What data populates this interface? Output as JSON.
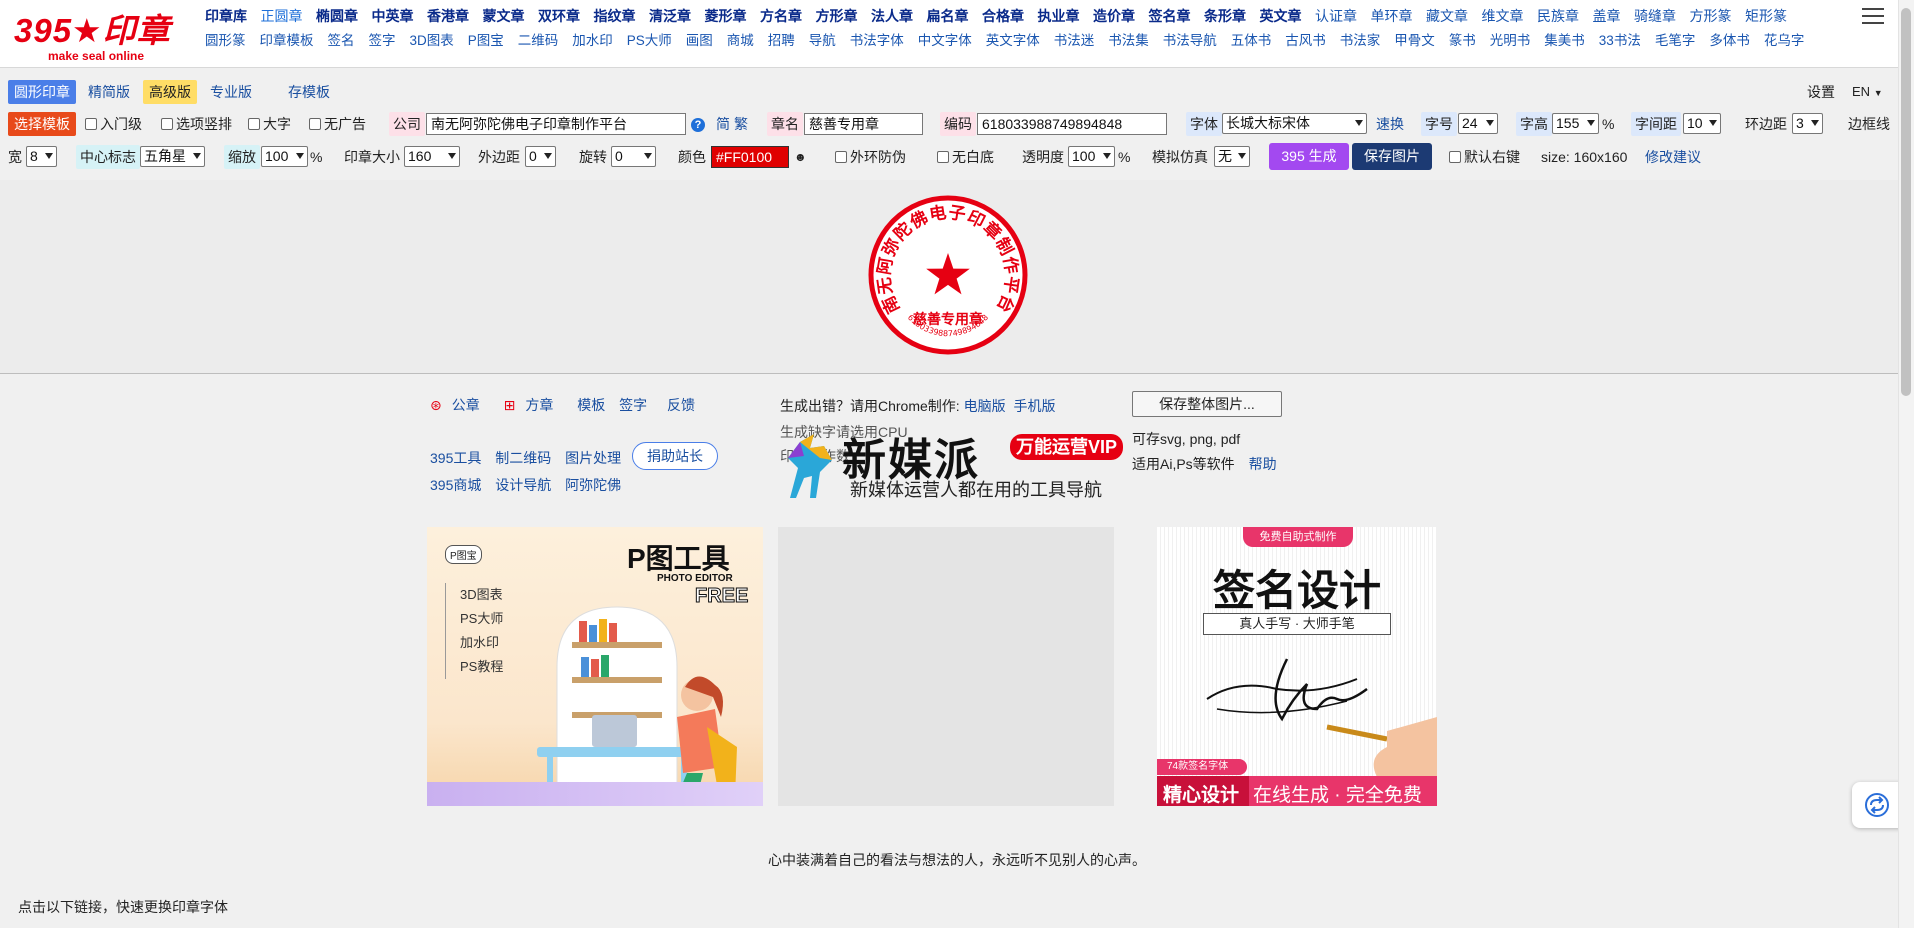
{
  "logo": {
    "title": "395★印章",
    "subtitle": "make seal online"
  },
  "nav": {
    "row1": [
      "印章库",
      "正圆章",
      "椭圆章",
      "中英章",
      "香港章",
      "蒙文章",
      "双环章",
      "指纹章",
      "清泛章",
      "菱形章",
      "方名章",
      "方形章",
      "法人章",
      "扁名章",
      "合格章",
      "执业章",
      "造价章",
      "签名章",
      "条形章",
      "英文章",
      "认证章",
      "单环章",
      "藏文章",
      "维文章",
      "民族章",
      "盖章",
      "骑缝章",
      "方形篆",
      "矩形篆"
    ],
    "row2": [
      "圆形篆",
      "印章模板",
      "签名",
      "签字",
      "3D图表",
      "P图宝",
      "二维码",
      "加水印",
      "PS大师",
      "画图",
      "商城",
      "招聘",
      "导航",
      "书法字体",
      "中文字体",
      "英文字体",
      "书法迷",
      "书法集",
      "书法导航",
      "五体书",
      "古风书",
      "书法家",
      "甲骨文",
      "篆书",
      "光明书",
      "集美书",
      "33书法",
      "毛笔字",
      "多体书",
      "花乌字"
    ]
  },
  "toolbar": {
    "tabs": [
      "圆形印章",
      "精简版",
      "高级版",
      "专业版",
      "存模板"
    ],
    "settings": "设置",
    "lang": "EN",
    "choose_template": "选择模板",
    "opt_beginner": "入门级",
    "opt_vertical": "选项竖排",
    "opt_bigchar": "大字",
    "opt_noad": "无广告",
    "company_label": "公司",
    "company_value": "南无阿弥陀佛电子印章制作平台",
    "simp": "简",
    "trad": "繁",
    "seal_name_label": "章名",
    "seal_name_value": "慈善专用章",
    "code_label": "编码",
    "code_value": "618033988749894848",
    "font_label": "字体",
    "font_value": "长城大标宋体",
    "quick_switch": "速换",
    "font_size_label": "字号",
    "font_size_value": "24",
    "char_height_label": "字高",
    "char_height_value": "155",
    "percent": "%",
    "spacing_label": "字间距",
    "spacing_value": "10",
    "ring_margin_label": "环边距",
    "ring_margin_value": "3",
    "border_label": "边框线",
    "width_label": "宽",
    "width_value": "8",
    "center_logo_label": "中心标志",
    "center_logo_value": "五角星",
    "scale_label": "缩放",
    "scale_value": "100",
    "seal_size_label": "印章大小",
    "seal_size_value": "160",
    "outer_margin_label": "外边距",
    "outer_margin_value": "0",
    "rotate_label": "旋转",
    "rotate_value": "0",
    "color_label": "颜色",
    "color_value": "#FF0100",
    "anti_fake": "外环防伪",
    "no_white": "无白底",
    "opacity_label": "透明度",
    "opacity_value": "100",
    "sim_label": "模拟仿真",
    "sim_value": "无",
    "generate": "395 生成",
    "save_image": "保存图片",
    "default_right": "默认右键",
    "size_info": "size: 160x160",
    "suggest": "修改建议"
  },
  "stamp": {
    "company": "南无阿弥陀佛电子印章制作平台",
    "name": "慈善专用章",
    "code": "618033988749894848",
    "color": "#e60012"
  },
  "links": {
    "row1": [
      "公章",
      "方章",
      "模板",
      "签字",
      "反馈"
    ],
    "row2": [
      "395工具",
      "制二维码",
      "图片处理"
    ],
    "row3": [
      "395商城",
      "设计导航",
      "阿弥陀佛"
    ],
    "donate": "捐助站长"
  },
  "info": {
    "error_line": "生成出错？请用Chrome制作:",
    "pc": "电脑版",
    "mobile": "手机版",
    "save_full": "保存整体图片...",
    "formats": "可存svg, png, pdf",
    "software": "适用Ai,Ps等软件",
    "help": "帮助",
    "hidden1": "生成缺字请选用CPU",
    "hidden2": "印…制作数"
  },
  "ad_banner": {
    "title": "新媒派",
    "badge": "万能运营VIP",
    "subtitle": "新媒体运营人都在用的工具导航"
  },
  "card1": {
    "brand": "P图宝",
    "title": "P图工具",
    "en": "PHOTO EDITOR",
    "free": "FREE",
    "items": [
      "3D图表",
      "PS大师",
      "加水印",
      "PS教程"
    ]
  },
  "card3": {
    "top": "免费自助式制作",
    "title": "签名设计",
    "sub": "真人手写 · 大师手笔",
    "badge": "74款签名字体",
    "left": "精心设计",
    "right": "在线生成 · 完全免费"
  },
  "quote": "心中装满着自己的看法与想法的人，永远听不见别人的心声。",
  "footer_hint": "点击以下链接，快速更换印章字体"
}
